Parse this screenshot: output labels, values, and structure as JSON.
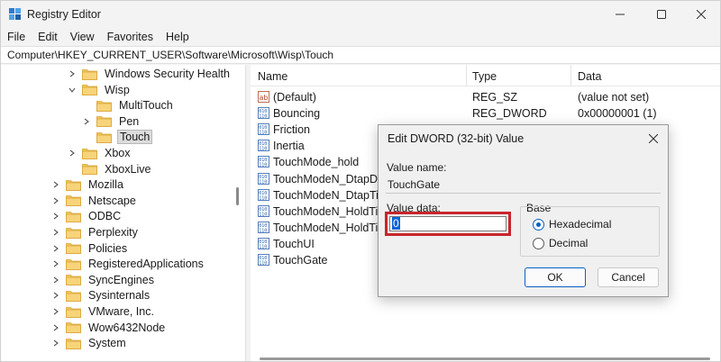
{
  "window": {
    "title": "Registry Editor",
    "icon": "registry-editor-icon"
  },
  "menu": [
    "File",
    "Edit",
    "View",
    "Favorites",
    "Help"
  ],
  "address": "Computer\\HKEY_CURRENT_USER\\Software\\Microsoft\\Wisp\\Touch",
  "tree": {
    "items": [
      {
        "label": "Windows Security Health",
        "expanded": false,
        "selected": false
      },
      {
        "label": "Wisp",
        "expanded": true,
        "selected": false
      },
      {
        "label": "MultiTouch",
        "expanded": false,
        "selected": false
      },
      {
        "label": "Pen",
        "expanded": false,
        "selected": false
      },
      {
        "label": "Touch",
        "expanded": false,
        "selected": true
      },
      {
        "label": "Xbox",
        "expanded": false,
        "selected": false
      },
      {
        "label": "XboxLive",
        "expanded": false,
        "selected": false
      },
      {
        "label": "Mozilla",
        "expanded": false,
        "selected": false
      },
      {
        "label": "Netscape",
        "expanded": false,
        "selected": false
      },
      {
        "label": "ODBC",
        "expanded": false,
        "selected": false
      },
      {
        "label": "Perplexity",
        "expanded": false,
        "selected": false
      },
      {
        "label": "Policies",
        "expanded": false,
        "selected": false
      },
      {
        "label": "RegisteredApplications",
        "expanded": false,
        "selected": false
      },
      {
        "label": "SyncEngines",
        "expanded": false,
        "selected": false
      },
      {
        "label": "Sysinternals",
        "expanded": false,
        "selected": false
      },
      {
        "label": "VMware, Inc.",
        "expanded": false,
        "selected": false
      },
      {
        "label": "Wow6432Node",
        "expanded": false,
        "selected": false
      },
      {
        "label": "System",
        "expanded": false,
        "selected": false
      }
    ]
  },
  "list": {
    "columns": [
      "Name",
      "Type",
      "Data"
    ],
    "rows": [
      {
        "name": "(Default)",
        "type": "REG_SZ",
        "data": "(value not set)",
        "icon": "string-value-icon"
      },
      {
        "name": "Bouncing",
        "type": "REG_DWORD",
        "data": "0x00000001 (1)",
        "icon": "binary-value-icon"
      },
      {
        "name": "Friction",
        "type": "",
        "data": "",
        "icon": "binary-value-icon"
      },
      {
        "name": "Inertia",
        "type": "",
        "data": "",
        "icon": "binary-value-icon"
      },
      {
        "name": "TouchMode_hold",
        "type": "",
        "data": "",
        "icon": "binary-value-icon"
      },
      {
        "name": "TouchModeN_DtapDist",
        "type": "",
        "data": "",
        "icon": "binary-value-icon"
      },
      {
        "name": "TouchModeN_DtapTime",
        "type": "",
        "data": "",
        "icon": "binary-value-icon"
      },
      {
        "name": "TouchModeN_HoldTime",
        "type": "",
        "data": "",
        "icon": "binary-value-icon"
      },
      {
        "name": "TouchModeN_HoldTime",
        "type": "",
        "data": "",
        "icon": "binary-value-icon"
      },
      {
        "name": "TouchUI",
        "type": "",
        "data": "",
        "icon": "binary-value-icon"
      },
      {
        "name": "TouchGate",
        "type": "",
        "data": "",
        "icon": "binary-value-icon"
      }
    ]
  },
  "dialog": {
    "title": "Edit DWORD (32-bit) Value",
    "value_name_label": "Value name:",
    "value_name": "TouchGate",
    "value_data_label": "Value data:",
    "value_data": "0",
    "base_label": "Base",
    "base_options": [
      "Hexadecimal",
      "Decimal"
    ],
    "base_selected": "Hexadecimal",
    "ok_label": "OK",
    "cancel_label": "Cancel"
  },
  "colors": {
    "highlight_border": "#c8252c",
    "accent": "#0a5fc4",
    "folder": "#f2c55c"
  }
}
